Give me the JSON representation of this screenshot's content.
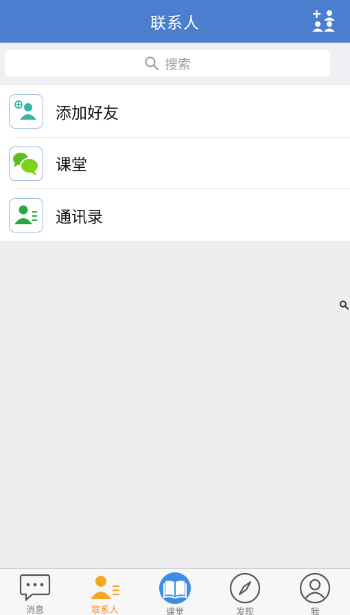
{
  "header": {
    "title": "联系人"
  },
  "search": {
    "placeholder": "搜索"
  },
  "items": [
    {
      "label": "添加好友"
    },
    {
      "label": "课堂"
    },
    {
      "label": "通讯录"
    }
  ],
  "tabbar": {
    "tabs": [
      {
        "label": "消息"
      },
      {
        "label": "联系人"
      },
      {
        "label": "课堂"
      },
      {
        "label": "发现"
      },
      {
        "label": "我"
      }
    ]
  },
  "colors": {
    "accent": "#4a7fcf",
    "active_tab": "#f08a24",
    "green": "#5cbf1e",
    "teal": "#35b5a4"
  },
  "icons": {
    "header_action": "add-contact-icon",
    "add_friend": "add-friend-icon",
    "classroom": "chat-bubbles-icon",
    "contacts": "contact-book-icon"
  }
}
